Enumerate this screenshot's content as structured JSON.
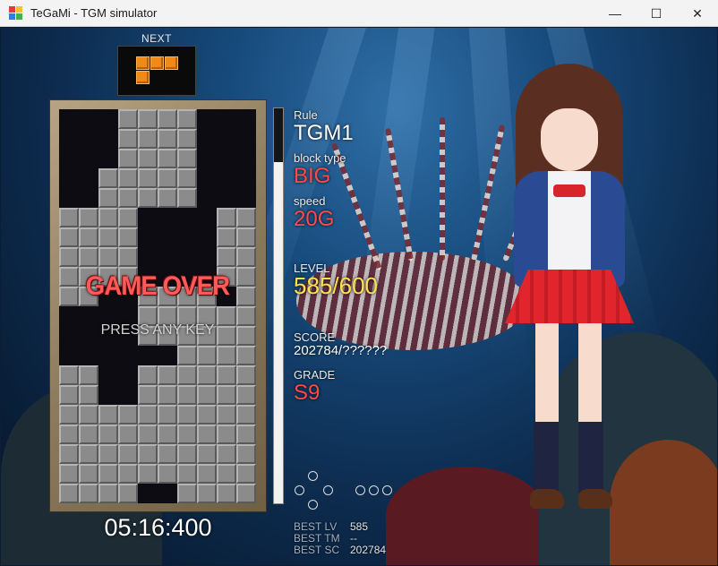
{
  "window": {
    "title": "TeGaMi - TGM simulator",
    "minimize_glyph": "—",
    "maximize_glyph": "☐",
    "close_glyph": "✕"
  },
  "next": {
    "label": "NEXT",
    "piece": "L",
    "color": "#ef8a16"
  },
  "playfield": {
    "columns": 10,
    "rows": 20,
    "rows_data": [
      "...####...",
      "...####...",
      "...####...",
      "..#####...",
      "..#####...",
      "####....##",
      "####....##",
      "####....##",
      "####....##",
      "##..####.#",
      "....######",
      "....######",
      "......####",
      "##..######",
      "##..######",
      "##########",
      "##########",
      "##########",
      "##########",
      "####..####"
    ]
  },
  "overlay": {
    "game_over": "GAME OVER",
    "press_any_key": "PRESS ANY KEY"
  },
  "timer": "05:16:400",
  "gauge": {
    "level": 585,
    "max": 600
  },
  "info": {
    "rule_label": "Rule",
    "rule_value": "TGM1",
    "block_type_label": "block type",
    "block_type_value": "BIG",
    "speed_label": "speed",
    "speed_value": "20G",
    "level_label": "LEVEL",
    "level_value": "585/600",
    "score_label": "SCORE",
    "score_value": "202784/??????",
    "grade_label": "GRADE",
    "grade_value": "S9"
  },
  "best": {
    "lv_label": "BEST LV",
    "lv_value": "585",
    "tm_label": "BEST TM",
    "tm_value": "--",
    "sc_label": "BEST SC",
    "sc_value": "202784"
  },
  "colors": {
    "accent_red": "#ff4a4a",
    "accent_yellow": "#ffe04a",
    "block_gray": "#8b8b8b"
  }
}
